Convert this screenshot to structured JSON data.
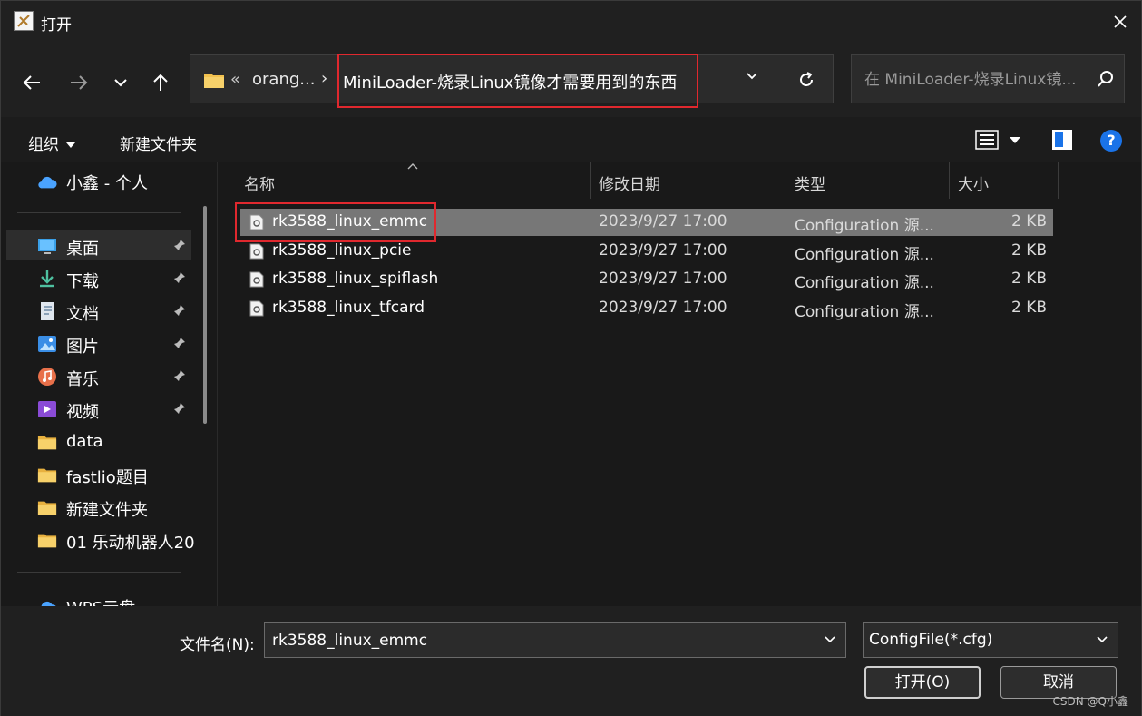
{
  "window": {
    "title": "打开"
  },
  "address": {
    "overflow": "«",
    "crumb1": "orang...",
    "separator": "›",
    "current": "MiniLoader-烧录Linux镜像才需要用到的东西"
  },
  "search": {
    "placeholder": "在 MiniLoader-烧录Linux镜..."
  },
  "toolbar": {
    "organize": "组织",
    "new_folder": "新建文件夹"
  },
  "sidebar": {
    "onedrive": "小鑫 - 个人",
    "items": [
      {
        "label": "桌面",
        "icon": "desktop-icon",
        "pinned": true
      },
      {
        "label": "下载",
        "icon": "download-icon",
        "pinned": true
      },
      {
        "label": "文档",
        "icon": "document-icon",
        "pinned": true
      },
      {
        "label": "图片",
        "icon": "pictures-icon",
        "pinned": true
      },
      {
        "label": "音乐",
        "icon": "music-icon",
        "pinned": true
      },
      {
        "label": "视频",
        "icon": "video-icon",
        "pinned": true
      },
      {
        "label": "data",
        "icon": "folder-icon",
        "pinned": false
      },
      {
        "label": "fastlio题目",
        "icon": "folder-icon",
        "pinned": false
      },
      {
        "label": "新建文件夹",
        "icon": "folder-icon",
        "pinned": false
      },
      {
        "label": "01 乐动机器人20",
        "icon": "folder-icon",
        "pinned": false
      }
    ],
    "wps": "WPS云盘"
  },
  "columns": {
    "name": "名称",
    "date": "修改日期",
    "type": "类型",
    "size": "大小"
  },
  "files": [
    {
      "name": "rk3588_linux_emmc",
      "date": "2023/9/27 17:00",
      "type": "Configuration 源...",
      "size": "2 KB"
    },
    {
      "name": "rk3588_linux_pcie",
      "date": "2023/9/27 17:00",
      "type": "Configuration 源...",
      "size": "2 KB"
    },
    {
      "name": "rk3588_linux_spiflash",
      "date": "2023/9/27 17:00",
      "type": "Configuration 源...",
      "size": "2 KB"
    },
    {
      "name": "rk3588_linux_tfcard",
      "date": "2023/9/27 17:00",
      "type": "Configuration 源...",
      "size": "2 KB"
    }
  ],
  "bottom": {
    "filename_label": "文件名(N):",
    "filename_value": "rk3588_linux_emmc",
    "filter": "ConfigFile(*.cfg)",
    "open": "打开(O)",
    "cancel": "取消"
  },
  "watermark": "CSDN @Q小鑫",
  "colors": {
    "highlight": "#e0282e",
    "selected_row": "#777777",
    "accent": "#1a73e8"
  }
}
